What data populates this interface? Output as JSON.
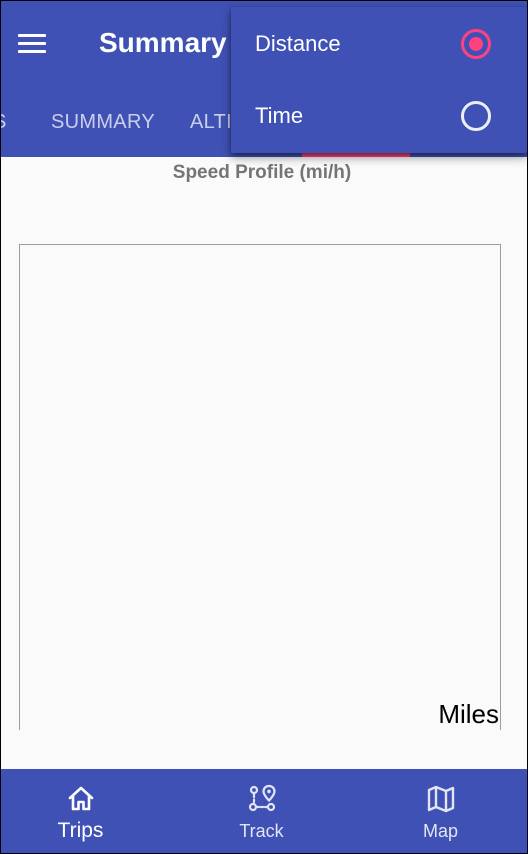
{
  "app_bar": {
    "title": "Summary",
    "tabs": [
      {
        "label": "S"
      },
      {
        "label": "SUMMARY"
      },
      {
        "label": "ALTI"
      }
    ]
  },
  "chart": {
    "title": "Speed Profile (mi/h)",
    "x_axis_label": "Miles"
  },
  "popup_menu": {
    "items": [
      {
        "label": "Distance",
        "checked": true
      },
      {
        "label": "Time",
        "checked": false
      }
    ]
  },
  "bottom_nav": {
    "items": [
      {
        "label": "Trips",
        "icon": "home-icon",
        "active": true
      },
      {
        "label": "Track",
        "icon": "route-icon",
        "active": false
      },
      {
        "label": "Map",
        "icon": "map-icon",
        "active": false
      }
    ]
  },
  "colors": {
    "primary": "#3f51b5",
    "accent": "#ff4081",
    "background": "#fafafa"
  }
}
